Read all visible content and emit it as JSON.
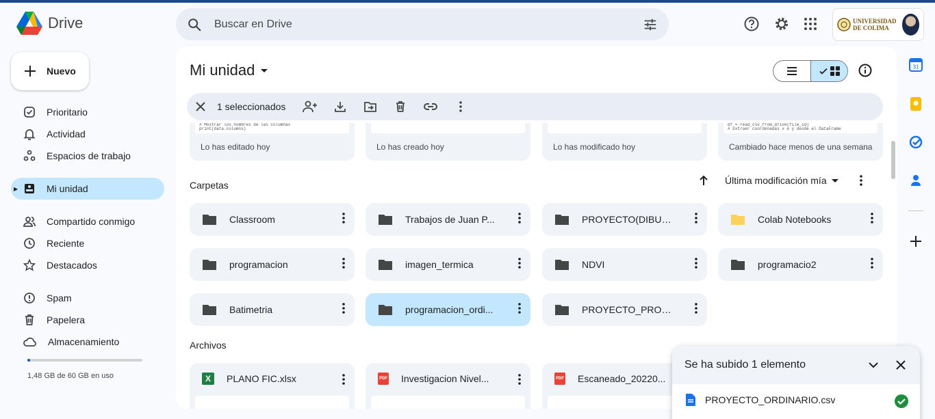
{
  "app": {
    "name": "Drive"
  },
  "search": {
    "placeholder": "Buscar en Drive"
  },
  "account": {
    "org_line1": "UNIVERSIDAD",
    "org_line2": "DE COLIMA"
  },
  "sidebar": {
    "new_label": "Nuevo",
    "items": [
      {
        "label": "Prioritario",
        "icon": "priority-icon"
      },
      {
        "label": "Actividad",
        "icon": "bell-icon"
      },
      {
        "label": "Espacios de trabajo",
        "icon": "workspaces-icon"
      },
      {
        "label": "Mi unidad",
        "icon": "my-drive-icon",
        "active": true
      },
      {
        "label": "Compartido conmigo",
        "icon": "shared-icon"
      },
      {
        "label": "Reciente",
        "icon": "clock-icon"
      },
      {
        "label": "Destacados",
        "icon": "star-icon"
      },
      {
        "label": "Spam",
        "icon": "spam-icon"
      },
      {
        "label": "Papelera",
        "icon": "trash-icon"
      },
      {
        "label": "Almacenamiento",
        "icon": "cloud-icon"
      }
    ],
    "storage_text": "1,48 GB de 60 GB en uso",
    "storage_fraction": 0.025
  },
  "main": {
    "title": "Mi unidad",
    "selection_text": "1 seleccionados",
    "recent_cards": [
      {
        "code": "# Mostrar los nombres de las columnas\nprint(data.columns)",
        "meta": "Lo has editado hoy"
      },
      {
        "code": "",
        "meta": "Lo has creado hoy"
      },
      {
        "code": "",
        "meta": "Lo has modificado hoy"
      },
      {
        "code": "df = read_csv_from_drive(file_id)\n# Extraer coordenadas x e y desde el DataFrame",
        "meta": "Cambiado hace menos de una semana"
      }
    ],
    "folders_label": "Carpetas",
    "sort_label": "Última modificación mía",
    "folders": [
      {
        "name": "Classroom"
      },
      {
        "name": "Trabajos de Juan P..."
      },
      {
        "name": "PROYECTO(DIBUJO)"
      },
      {
        "name": "Colab Notebooks",
        "color": "#fbd25b"
      },
      {
        "name": "programacion"
      },
      {
        "name": "imagen_termica"
      },
      {
        "name": "NDVI"
      },
      {
        "name": "programacio2"
      },
      {
        "name": "Batimetria"
      },
      {
        "name": "programacion_ordi...",
        "selected": true
      },
      {
        "name": "PROYECTO_PROG..."
      }
    ],
    "files_label": "Archivos",
    "files": [
      {
        "name": "PLANO FIC.xlsx",
        "type": "X"
      },
      {
        "name": "Investigacion Nivel...",
        "type": "PDF"
      },
      {
        "name": "Escaneado_20220...",
        "type": "PDF"
      }
    ]
  },
  "toast": {
    "title": "Se ha subido 1 elemento",
    "item": "PROYECTO_ORDINARIO.csv"
  },
  "colors": {
    "accent": "#0b57d0",
    "selected": "#c2e7ff",
    "success": "#1e8e3e"
  }
}
